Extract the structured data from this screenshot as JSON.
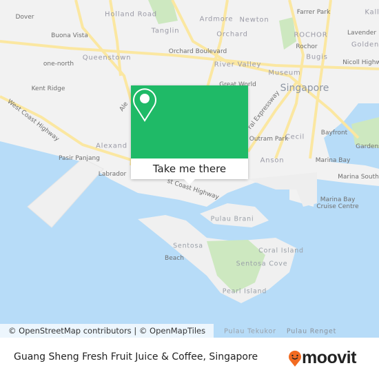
{
  "map": {
    "colors": {
      "water": "#b7dcf8",
      "land": "#f2f2f2",
      "park": "#cde8c0",
      "road": "#fbe7a1"
    },
    "labels": {
      "dover": "Dover",
      "holland_road": "Holland Road",
      "ardmore": "Ardmore",
      "newton": "Newton",
      "farrer_park": "Farrer Park",
      "kall": "Kall",
      "buona_vista": "Buona Vista",
      "tanglin": "Tanglin",
      "orchard": "Orchard",
      "rochor_district": "ROCHOR",
      "lavender": "Lavender",
      "rochor": "Rochor",
      "golden": "Golden",
      "orchard_boulevard": "Orchard Boulevard",
      "queenstown": "Queenstown",
      "one_north": "one-north",
      "river_valley": "River Valley",
      "bugis": "Bugis",
      "nicoll_highway": "Nicoll Highw",
      "museum": "Museum",
      "singapore": "Singapore",
      "kent_ridge": "Kent Ridge",
      "great_world": "Great World",
      "west_coast_highway": "West Coast Highway",
      "alexandra": "Alexand",
      "outram_park": "Outram Park",
      "cecil": "Cecil",
      "bayfront": "Bayfront",
      "gardens": "Gardens",
      "pasir_panjang": "Pasir Panjang",
      "anson": "Anson",
      "marina_bay": "Marina Bay",
      "marina_south": "Marina South",
      "labrador": "Labrador",
      "cruise_centre": "Marina Bay Cruise Centre",
      "pulau_brani": "Pulau Brani",
      "sentosa": "Sentosa",
      "beach": "Beach",
      "coral_island": "Coral Island",
      "sentosa_cove": "Sentosa Cove",
      "pearl_island": "Pearl Island",
      "pulau_tekukor": "Pulau Tekukor",
      "pulau_renget": "Pulau Renget",
      "central_expressway": "ral Expressway",
      "west_coast_highway_2": "st Coast Highway",
      "alexandra_road": "Ale"
    },
    "attribution": "© OpenStreetMap contributors | © OpenMapTiles"
  },
  "popup": {
    "icon": "map-pin-icon",
    "button_label": "Take me there",
    "color": "#1fba67"
  },
  "footer": {
    "title": "Guang Sheng Fresh Fruit Juice & Coffee, Singapore",
    "logo_text": "moovit",
    "logo_color": "#f26b21"
  }
}
